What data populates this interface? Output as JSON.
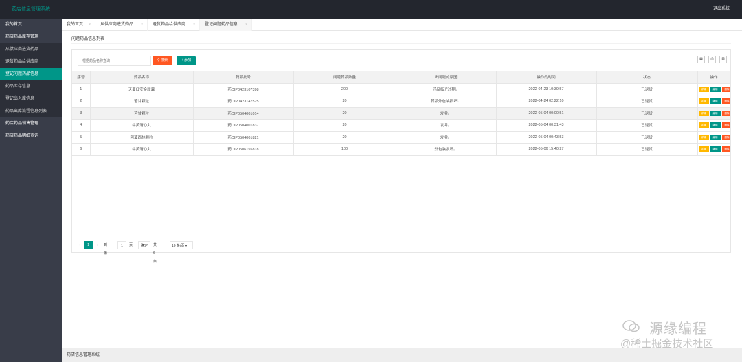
{
  "header": {
    "app_title": "药店信息管理系统",
    "logout": "退出系统"
  },
  "sidebar": {
    "items": [
      {
        "label": "我的首页",
        "type": "top"
      },
      {
        "label": "药店药品库存管理",
        "type": "top"
      },
      {
        "label": "从供应商进货药品",
        "type": "sub"
      },
      {
        "label": "退货药品给供应商",
        "type": "sub"
      },
      {
        "label": "登记问题药品信息",
        "type": "sub-active"
      },
      {
        "label": "药品库存信息",
        "type": "sub"
      },
      {
        "label": "登记出入库信息",
        "type": "sub"
      },
      {
        "label": "药品出库流程信息列表",
        "type": "sub"
      },
      {
        "label": "药店药品销售管理",
        "type": "top"
      },
      {
        "label": "药店药品明细查询",
        "type": "top"
      }
    ]
  },
  "tabs": [
    {
      "label": "我的首页",
      "close": "×"
    },
    {
      "label": "从供应商进货药品",
      "close": "×"
    },
    {
      "label": "退货药品给供应商",
      "close": "×"
    },
    {
      "label": "登记问题药品信息",
      "close": "×"
    }
  ],
  "page": {
    "title": "问题药品信息列表"
  },
  "toolbar": {
    "search_placeholder": "根据药品名称查询",
    "search_button": "搜索",
    "add_button": "+ 添加",
    "icons": [
      "columns-icon",
      "print-icon",
      "export-icon"
    ]
  },
  "table": {
    "columns": [
      "序号",
      "药品名称",
      "药品批号",
      "问题药品数量",
      "出问题的原因",
      "操作的时间",
      "状态",
      "操作"
    ],
    "rows": [
      [
        "1",
        "天麦红安金胶囊",
        "药DIP0423107398",
        "200",
        "药品临近过期。",
        "2022-04-23 10:39:57",
        "已退货"
      ],
      [
        "2",
        "苦甘颗粒",
        "药DIP0423147525",
        "20",
        "药品外包装损坏。",
        "2022-04-24 02:22:10",
        "已退货"
      ],
      [
        "3",
        "苦甘颗粒",
        "药DIP0504001014",
        "20",
        "发霉。",
        "2022-05-04 00:00:51",
        "已退货"
      ],
      [
        "4",
        "牛黄清心丸",
        "药DIP0504001837",
        "20",
        "发霉。",
        "2022-05-04 00:31:43",
        "已退货"
      ],
      [
        "5",
        "阿莫西林颗粒",
        "药DIP0504001821",
        "20",
        "发霉。",
        "2022-05-04 00:43:53",
        "已退货"
      ],
      [
        "6",
        "牛黄清心丸",
        "药DIP0506155818",
        "100",
        "外包装损坏。",
        "2022-05-06 15:40:27",
        "已退货"
      ]
    ],
    "highlighted_row": 3,
    "actions": [
      "详情",
      "编辑",
      "删除"
    ]
  },
  "pager": {
    "prev": "‹",
    "current": "1",
    "next": "›",
    "goto_label": "到第",
    "goto_value": "1",
    "page_unit": "页",
    "confirm": "确定",
    "total": "共 6 条",
    "per_page": "10 条/页 ▾"
  },
  "footer": {
    "text": "药店信息管理系统"
  },
  "watermark": {
    "line1": "源缘编程",
    "line2": "@稀土掘金技术社区"
  },
  "colors": {
    "header_bg": "#23262e",
    "sidebar_bg": "#393d49",
    "accent": "#009688",
    "danger": "#ff5722",
    "warn": "#ffb800"
  }
}
